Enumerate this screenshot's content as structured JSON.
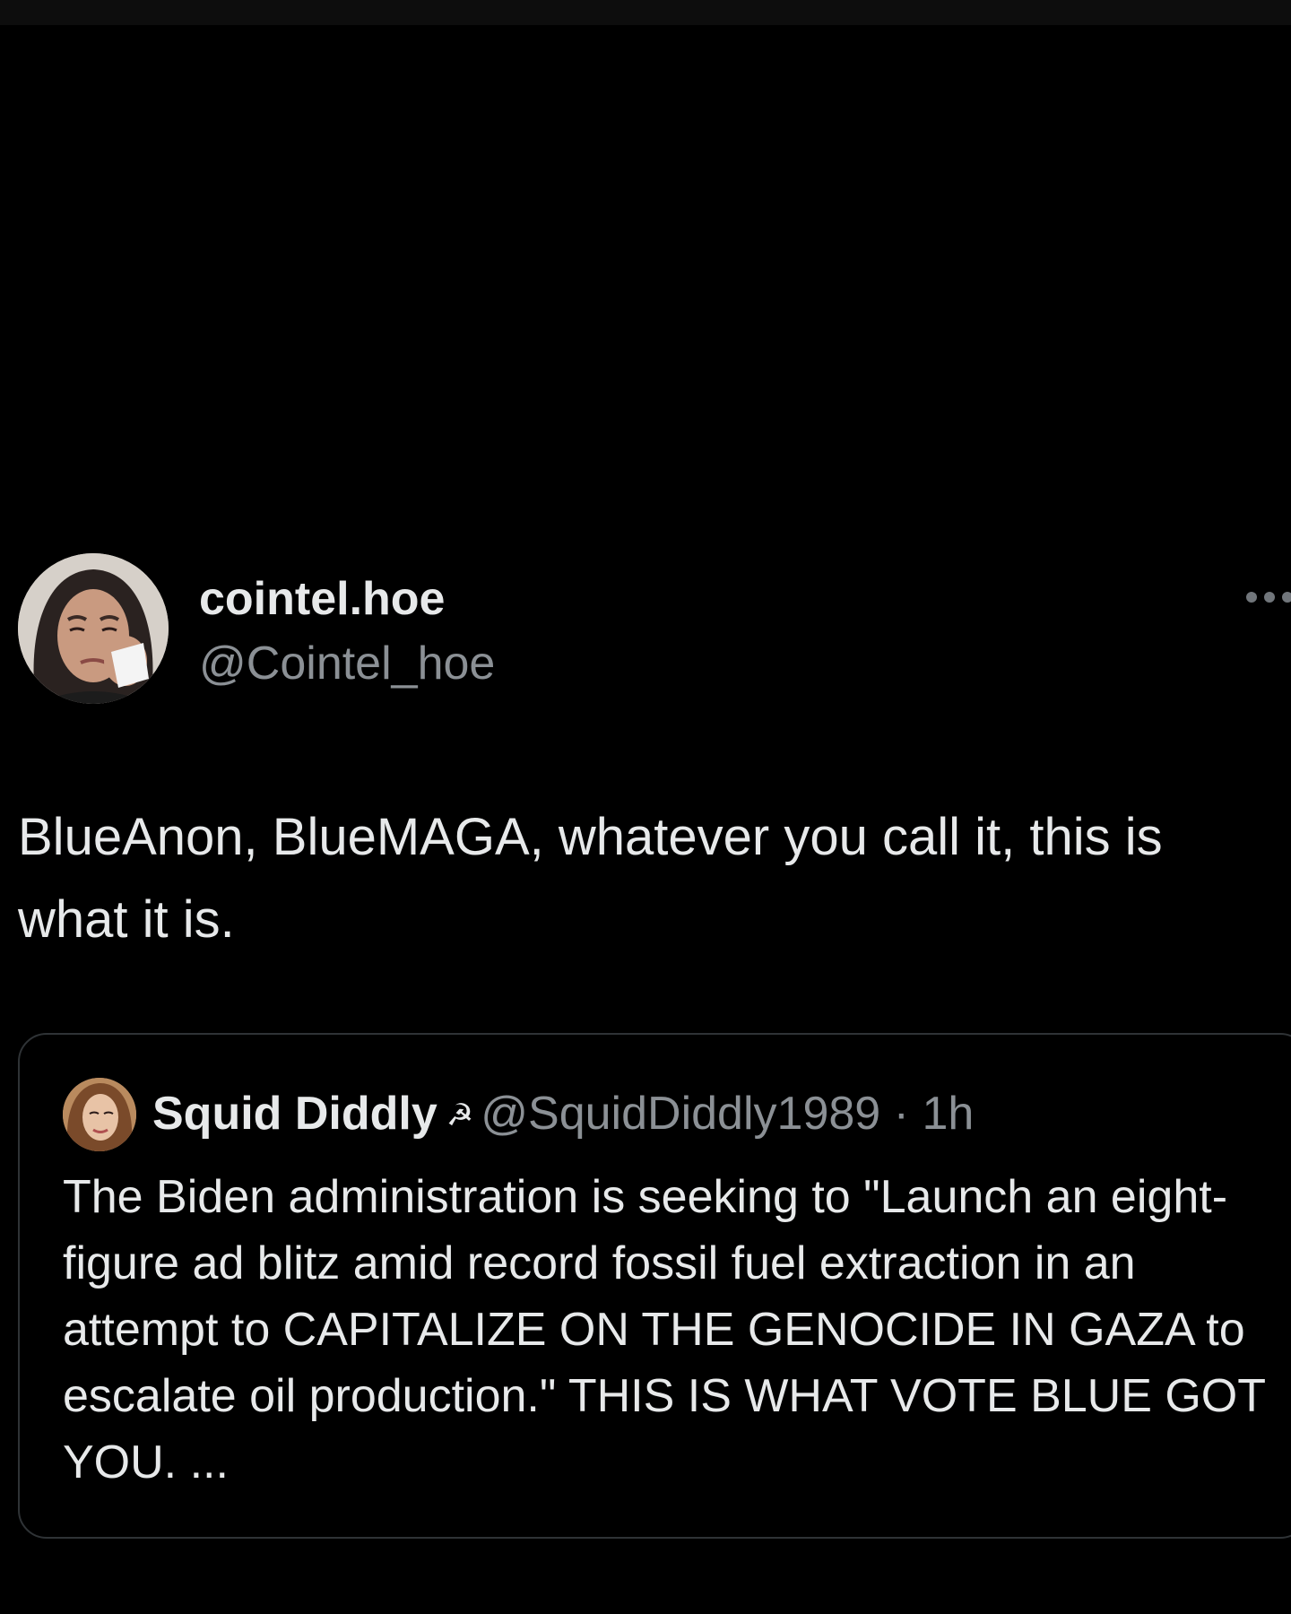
{
  "post": {
    "author_name": "cointel.hoe",
    "author_handle": "@Cointel_hoe",
    "avatar_icon": "user-avatar",
    "more_icon": "more-options-icon",
    "text": "BlueAnon, BlueMAGA, whatever you call it, this is what it is."
  },
  "quoted_post": {
    "author_name": "Squid Diddly",
    "badge_icon": "☭",
    "author_handle": "@SquidDiddly1989",
    "separator": "·",
    "time": "1h",
    "text": "The Biden administration is seeking to \"Launch an eight-figure ad blitz amid record fossil fuel extraction in an attempt to CAPITALIZE ON THE GENOCIDE IN GAZA to escalate oil production.\" THIS IS WHAT VOTE BLUE GOT YOU. ..."
  },
  "colors": {
    "background": "#000000",
    "text_primary": "#e7e9ea",
    "text_secondary": "#8b9095",
    "border": "#2f3336"
  }
}
